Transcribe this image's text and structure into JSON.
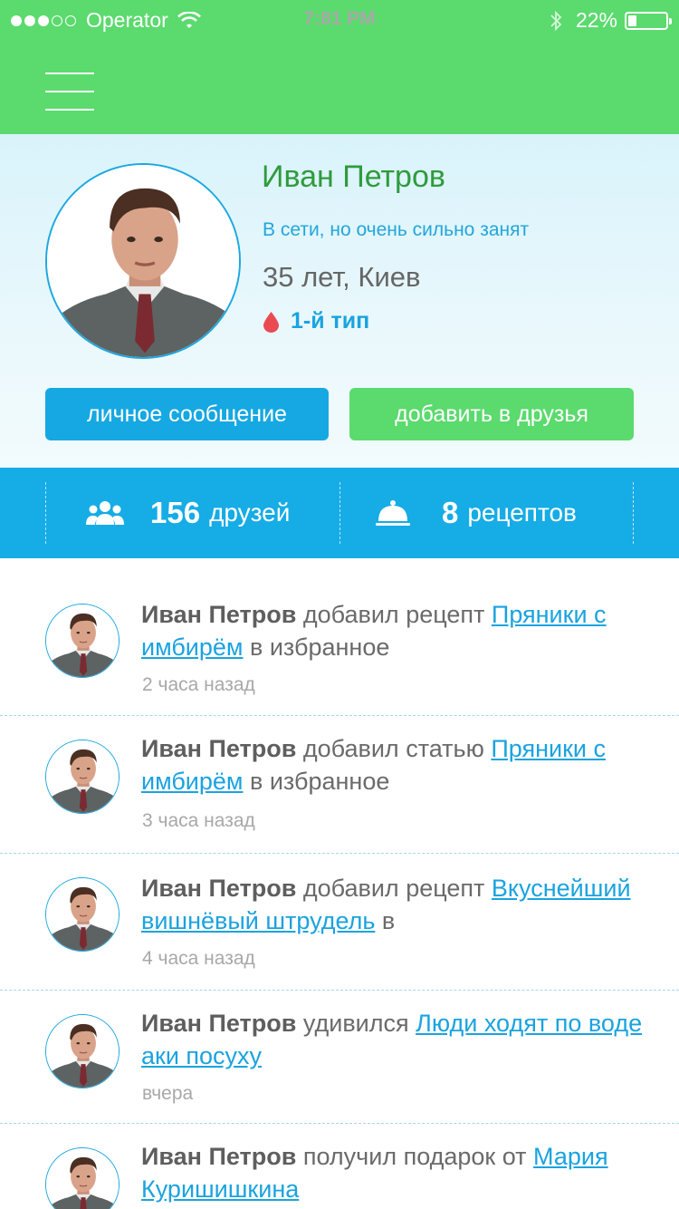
{
  "status_bar": {
    "carrier": "Operator",
    "time": "7:81 PM",
    "battery": "22%"
  },
  "profile": {
    "name": "Иван Петров",
    "status": "В сети, но очень сильно занят",
    "age_city": "35 лет, Киев",
    "blood_type": "1-й тип",
    "message_button": "личное сообщение",
    "add_friend_button": "добавить в друзья"
  },
  "stats": {
    "friends_count": "156",
    "friends_label": "друзей",
    "recipes_count": "8",
    "recipes_label": "рецептов"
  },
  "feed": [
    {
      "author": "Иван Петров",
      "action": "добавил рецепт",
      "link": "Пряники с имбирём",
      "suffix": "в избранное",
      "time": "2 часа назад"
    },
    {
      "author": "Иван Петров",
      "action": "добавил статью",
      "link": "Пряники с имбирём",
      "suffix": "в избранное",
      "time": "3 часа назад"
    },
    {
      "author": "Иван Петров",
      "action": "добавил рецепт",
      "link": "Вкуснейший вишнёвый штрудель",
      "suffix": "в",
      "time": "4 часа назад"
    },
    {
      "author": "Иван Петров",
      "action": "удивился",
      "link": "Люди ходят по воде аки посуху",
      "suffix": "",
      "time": "вчера"
    },
    {
      "author": "Иван Петров",
      "action": "получил подарок от",
      "link": "Мария Куришишкина",
      "suffix": "",
      "time": ""
    }
  ],
  "colors": {
    "green": "#5bda6e",
    "blue": "#16a8e2",
    "name_green": "#2f9b3c",
    "text_gray": "#6a6a6a"
  },
  "icons": [
    "hamburger-menu-icon",
    "wifi-icon",
    "bluetooth-icon",
    "battery-icon",
    "blood-drop-icon",
    "friends-icon",
    "cloche-icon",
    "avatar-portrait"
  ]
}
